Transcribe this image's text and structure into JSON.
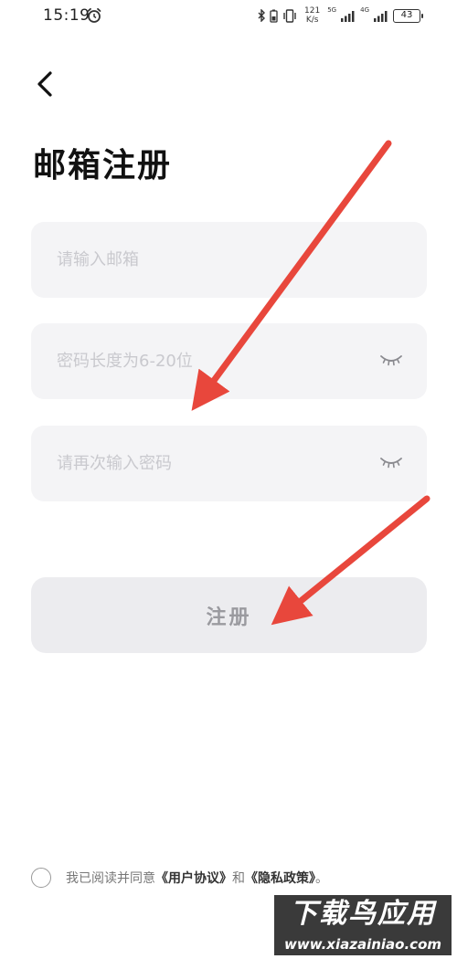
{
  "status_bar": {
    "time": "15:19",
    "speed_value": "121",
    "speed_unit": "K/s",
    "network_1": "5G",
    "network_2": "4G",
    "battery": "43",
    "icons": [
      "alarm-icon",
      "bluetooth-icon",
      "battery-saver-icon",
      "vibrate-icon",
      "signal-icon",
      "signal-icon"
    ]
  },
  "header": {
    "back_icon": "chevron-left-icon",
    "title": "邮箱注册"
  },
  "form": {
    "email_placeholder": "请输入邮箱",
    "password_placeholder": "密码长度为6-20位",
    "confirm_placeholder": "请再次输入密码",
    "eye_icon": "eye-closed-icon",
    "register_label": "注册"
  },
  "agreement": {
    "prefix": "我已阅读并同意",
    "user_agreement": "《用户协议》",
    "conjunction": "和",
    "privacy_policy": "《隐私政策》",
    "suffix": "。"
  },
  "watermark": {
    "main": "下载鸟应用",
    "sub": "www.xiazainiao.com"
  },
  "colors": {
    "annotation_arrow": "#e8473c",
    "field_bg": "#f4f4f6",
    "button_bg": "#ececef"
  }
}
